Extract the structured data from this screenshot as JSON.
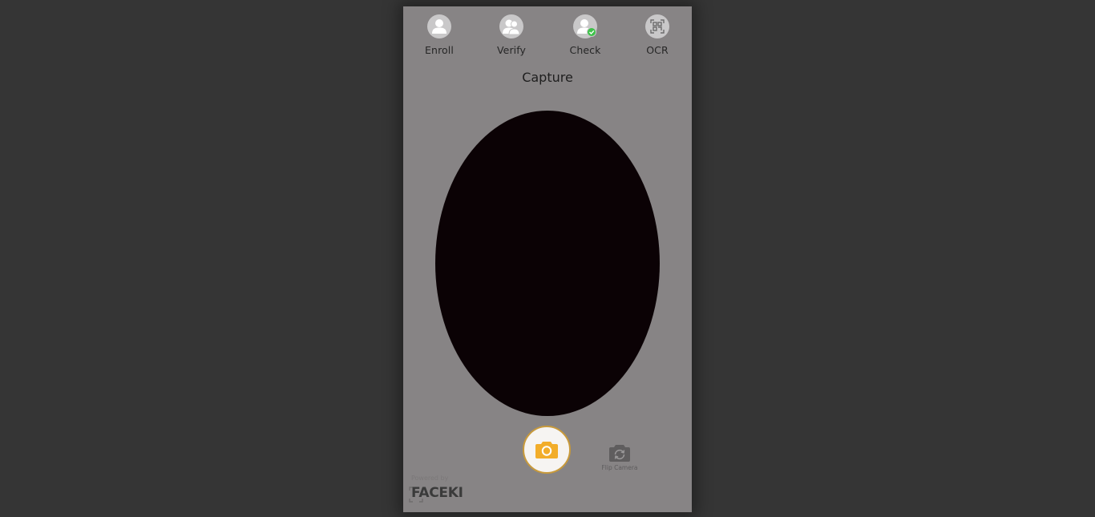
{
  "nav": {
    "items": [
      {
        "label": "Enroll",
        "icon": "person-icon"
      },
      {
        "label": "Verify",
        "icon": "people-icon"
      },
      {
        "label": "Check",
        "icon": "person-check-icon"
      },
      {
        "label": "OCR",
        "icon": "scan-icon"
      }
    ]
  },
  "page": {
    "title": "Capture"
  },
  "controls": {
    "capture_icon": "camera-icon",
    "flip_label": "Flip Camera",
    "flip_icon": "flip-camera-icon"
  },
  "footer": {
    "powered_by": "Powered by",
    "brand": "FACEKI"
  },
  "colors": {
    "background": "#353535",
    "panel": "#878485",
    "viewport": "#0b0205",
    "accent": "#f2ad2a",
    "check": "#3fc24a"
  }
}
